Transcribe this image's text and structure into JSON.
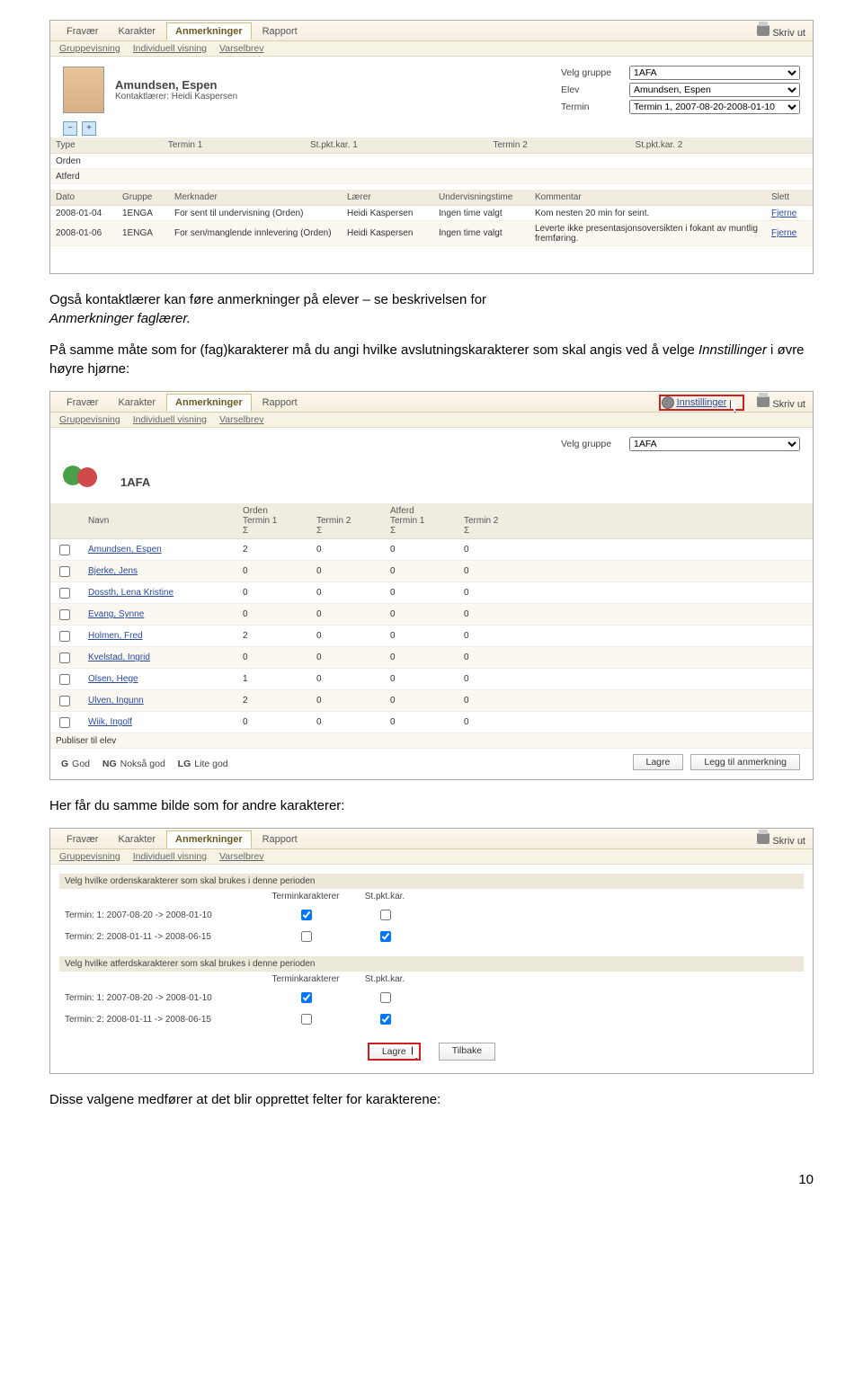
{
  "shot1": {
    "tabs": [
      "Fravær",
      "Karakter",
      "Anmerkninger",
      "Rapport"
    ],
    "active_tab": 2,
    "print": "Skriv ut",
    "subtabs": [
      "Gruppevisning",
      "Individuell visning",
      "Varselbrev"
    ],
    "name": "Amundsen, Espen",
    "sub": "Kontaktlærer: Heidi Kaspersen",
    "f_group_l": "Velg gruppe",
    "f_group_v": "1AFA",
    "f_elev_l": "Elev",
    "f_elev_v": "Amundsen, Espen",
    "f_term_l": "Termin",
    "f_term_v": "Termin 1, 2007-08-20-2008-01-10",
    "headA": [
      "Type",
      "Termin 1",
      "St.pkt.kar. 1",
      "Termin 2",
      "St.pkt.kar. 2"
    ],
    "rowsA": [
      "Orden",
      "Atferd"
    ],
    "headB": [
      "Dato",
      "Gruppe",
      "Merknader",
      "Lærer",
      "Undervisningstime",
      "Kommentar",
      "Slett"
    ],
    "rowsB": [
      [
        "2008-01-04",
        "1ENGA",
        "For sent til undervisning (Orden)",
        "Heidi Kaspersen",
        "Ingen time valgt",
        "Kom nesten 20 min for seint.",
        "Fjerne"
      ],
      [
        "2008-01-06",
        "1ENGA",
        "For sen/manglende innlevering (Orden)",
        "Heidi Kaspersen",
        "Ingen time valgt",
        "Leverte ikke presentasjonsoversikten i fokant av muntlig fremføring.",
        "Fjerne"
      ]
    ]
  },
  "para1": "Også kontaktlærer kan føre anmerkninger på elever – se beskrivelsen for ",
  "para1_i": "Anmerkninger faglærer.",
  "para2a": "På samme måte som for (fag)karakterer må du angi hvilke avslutningskarakterer som skal angis ved å velge ",
  "para2_i": "Innstillinger",
  "para2b": " i øvre høyre hjørne:",
  "shot2": {
    "tabs": [
      "Fravær",
      "Karakter",
      "Anmerkninger",
      "Rapport"
    ],
    "settings": "Innstillinger",
    "print": "Skriv ut",
    "subtabs": [
      "Gruppevisning",
      "Individuell visning",
      "Varselbrev"
    ],
    "group_name": "1AFA",
    "f_group_l": "Velg gruppe",
    "f_group_v": "1AFA",
    "head": [
      "",
      "Navn",
      "Orden\nTermin 1\nΣ",
      "\nTermin 2\nΣ",
      "Atferd\nTermin 1\nΣ",
      "\nTermin 2\nΣ"
    ],
    "rows": [
      [
        "Amundsen, Espen",
        "2",
        "0",
        "0",
        "0"
      ],
      [
        "Bjerke, Jens",
        "0",
        "0",
        "0",
        "0"
      ],
      [
        "Dossth, Lena Kristine",
        "0",
        "0",
        "0",
        "0"
      ],
      [
        "Evang, Synne",
        "0",
        "0",
        "0",
        "0"
      ],
      [
        "Holmen, Fred",
        "2",
        "0",
        "0",
        "0"
      ],
      [
        "Kvelstad, Ingrid",
        "0",
        "0",
        "0",
        "0"
      ],
      [
        "Olsen, Hege",
        "1",
        "0",
        "0",
        "0"
      ],
      [
        "Ulven, Ingunn",
        "2",
        "0",
        "0",
        "0"
      ],
      [
        "Wiik, Ingolf",
        "0",
        "0",
        "0",
        "0"
      ]
    ],
    "publish": "Publiser til elev",
    "legend_g": "G",
    "legend_gt": "God",
    "legend_ng": "NG",
    "legend_ngt": "Nokså god",
    "legend_lg": "LG",
    "legend_lgt": "Lite god",
    "btn_lagre": "Lagre",
    "btn_add": "Legg til anmerkning"
  },
  "para3": "Her får du samme bilde som for andre karakterer:",
  "shot3": {
    "tabs": [
      "Fravær",
      "Karakter",
      "Anmerkninger",
      "Rapport"
    ],
    "print": "Skriv ut",
    "subtabs": [
      "Gruppevisning",
      "Individuell visning",
      "Varselbrev"
    ],
    "q1": "Velg hvilke ordenskarakterer som skal brukes i denne perioden",
    "q2": "Velg hvilke atferdskarakterer som skal brukes i denne perioden",
    "h2": "Terminkarakterer",
    "h3": "St.pkt.kar.",
    "r1": "Termin: 1: 2007-08-20 -> 2008-01-10",
    "r2": "Termin: 2: 2008-01-11 -> 2008-06-15",
    "btn_lagre": "Lagre",
    "btn_back": "Tilbake"
  },
  "para4": "Disse valgene medfører at det blir opprettet felter for karakterene:",
  "pagenum": "10"
}
